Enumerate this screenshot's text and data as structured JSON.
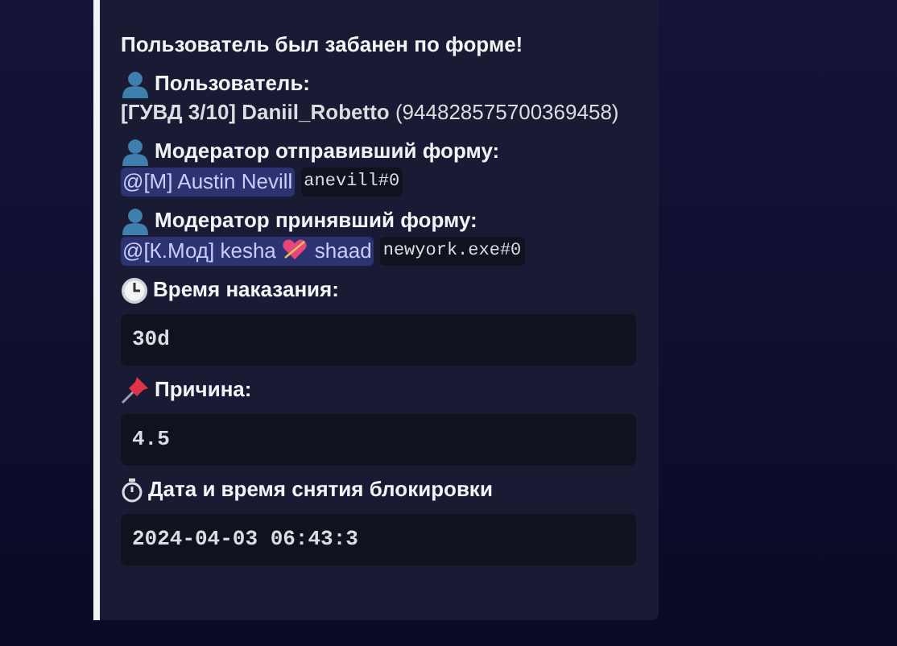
{
  "title": "Пользователь был забанен по форме!",
  "fields": [
    {
      "kind": "user",
      "label": "Пользователь:",
      "value": "**[ГУВД 3/10] Daniil_Robetto** (944828575700369458)"
    },
    {
      "kind": "mention",
      "label": "Модератор отправивший форму:",
      "mention": [
        "@[M] Austin Nevill"
      ],
      "tag": "anevill#0"
    },
    {
      "kind": "mention",
      "label": "Модератор принявший форму:",
      "mention": [
        "@[К.Мод] kesha",
        "shaad"
      ],
      "tag": "newyork.exe#0"
    },
    {
      "kind": "code",
      "label": "Время наказания:",
      "code": "30d"
    },
    {
      "kind": "code",
      "label": "Причина:",
      "code": "4.5"
    },
    {
      "kind": "code",
      "label": "Дата и время снятия блокировки",
      "code": "2024-04-03 06:43:3"
    }
  ]
}
